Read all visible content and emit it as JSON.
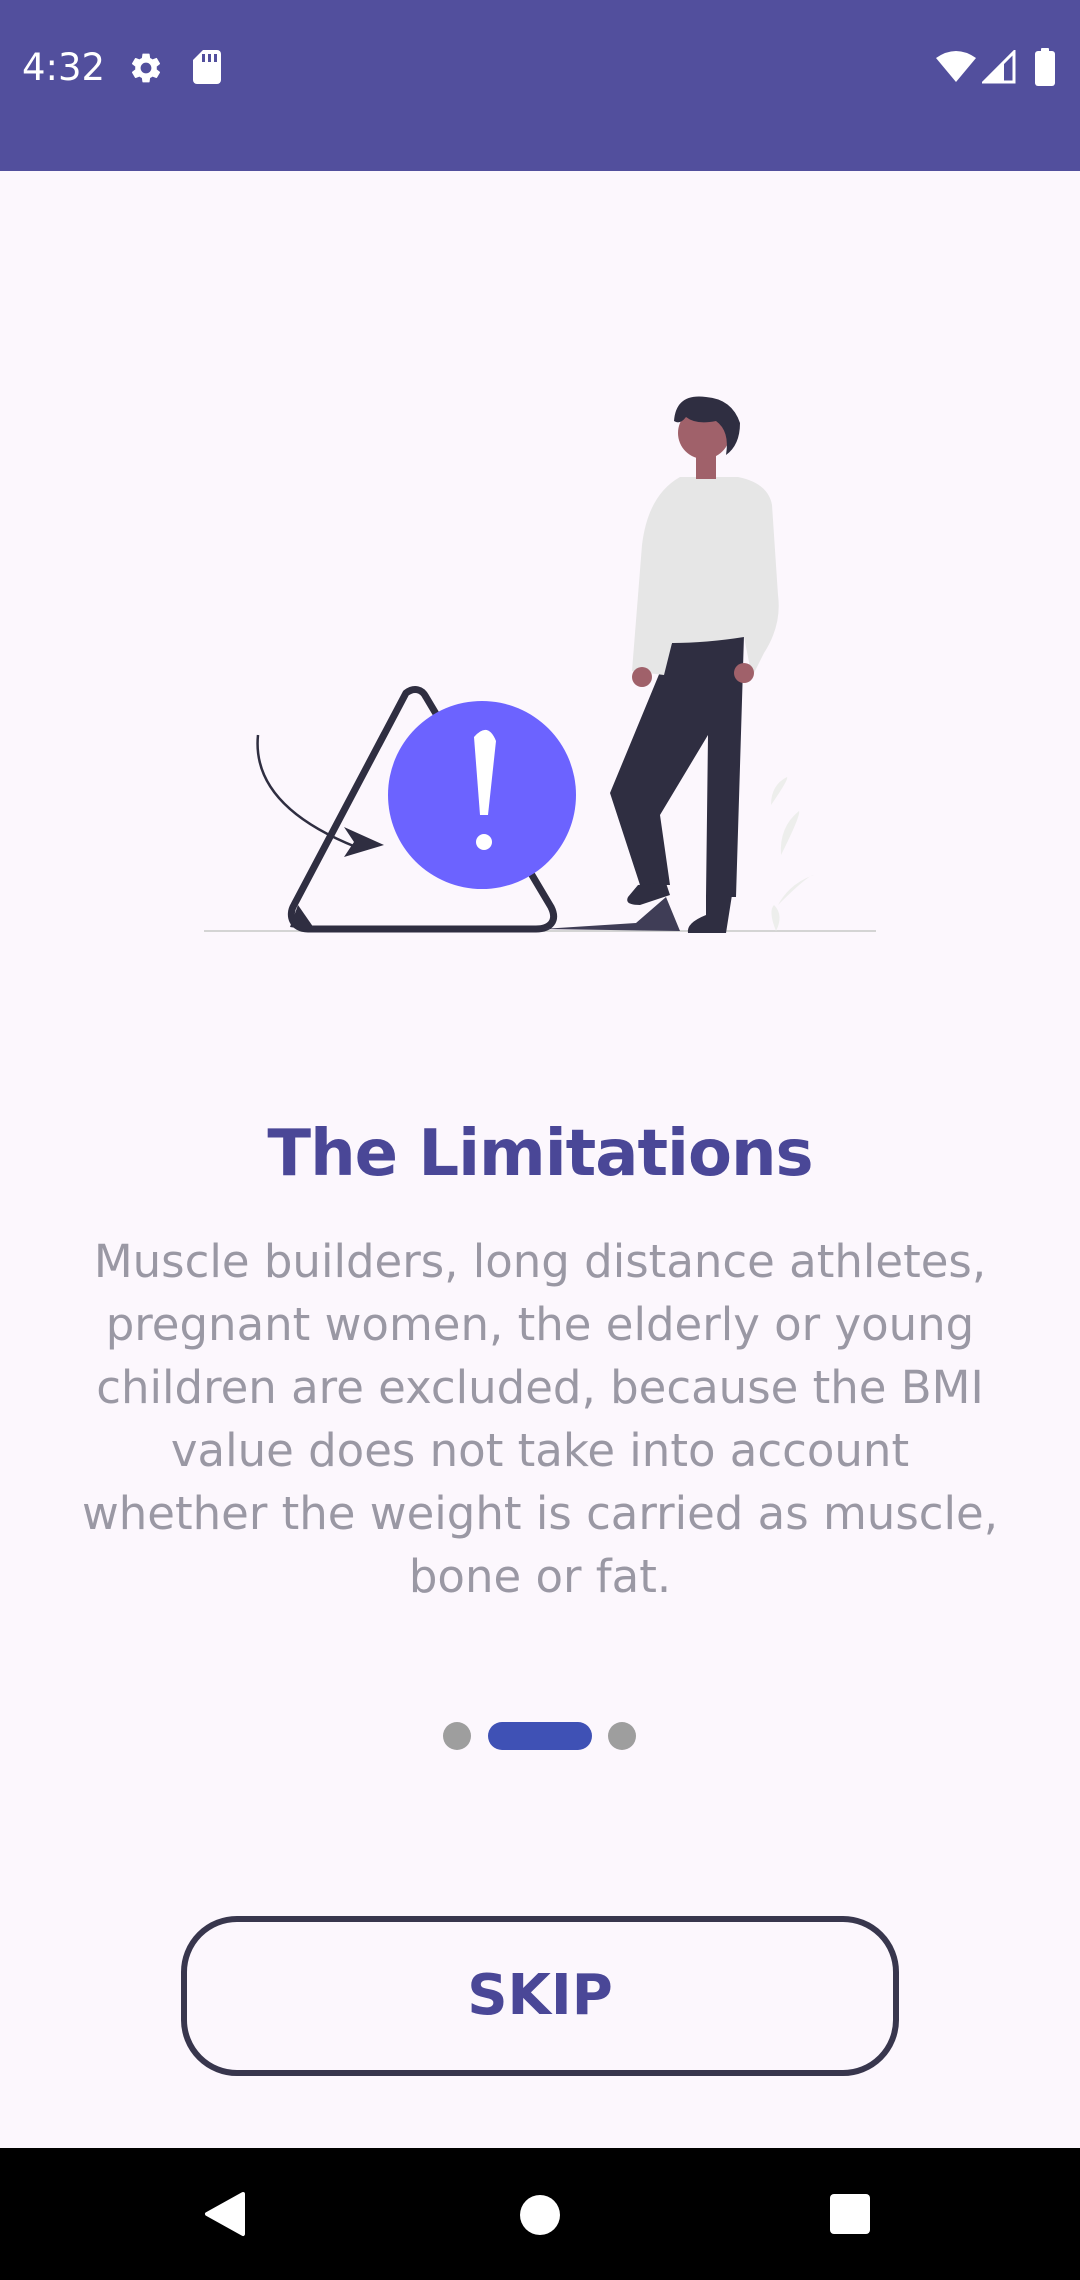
{
  "status_bar": {
    "time": "4:32",
    "icons_left": [
      "gear-icon",
      "sd-card-icon"
    ],
    "icons_right": [
      "wifi-icon",
      "signal-icon",
      "battery-icon"
    ],
    "background": "#524F9D"
  },
  "onboarding": {
    "illustration": "person-with-warning-triangle",
    "title": "The Limitations",
    "description": "Muscle builders, long distance athletes, pregnant women, the elderly or young children are excluded, because the BMI value does not take into account whether the weight is carried as muscle, bone or fat.",
    "page_indicator": {
      "total": 3,
      "current": 2
    },
    "skip_label": "SKIP"
  },
  "colors": {
    "accent": "#4A4797",
    "indicator_active": "#3F51B5",
    "indicator_inactive": "#9E9E9E",
    "warning_circle": "#6C63FF",
    "background": "#FCF7FD"
  },
  "nav_bar": {
    "buttons": [
      "back-icon",
      "home-icon",
      "recents-icon"
    ]
  }
}
